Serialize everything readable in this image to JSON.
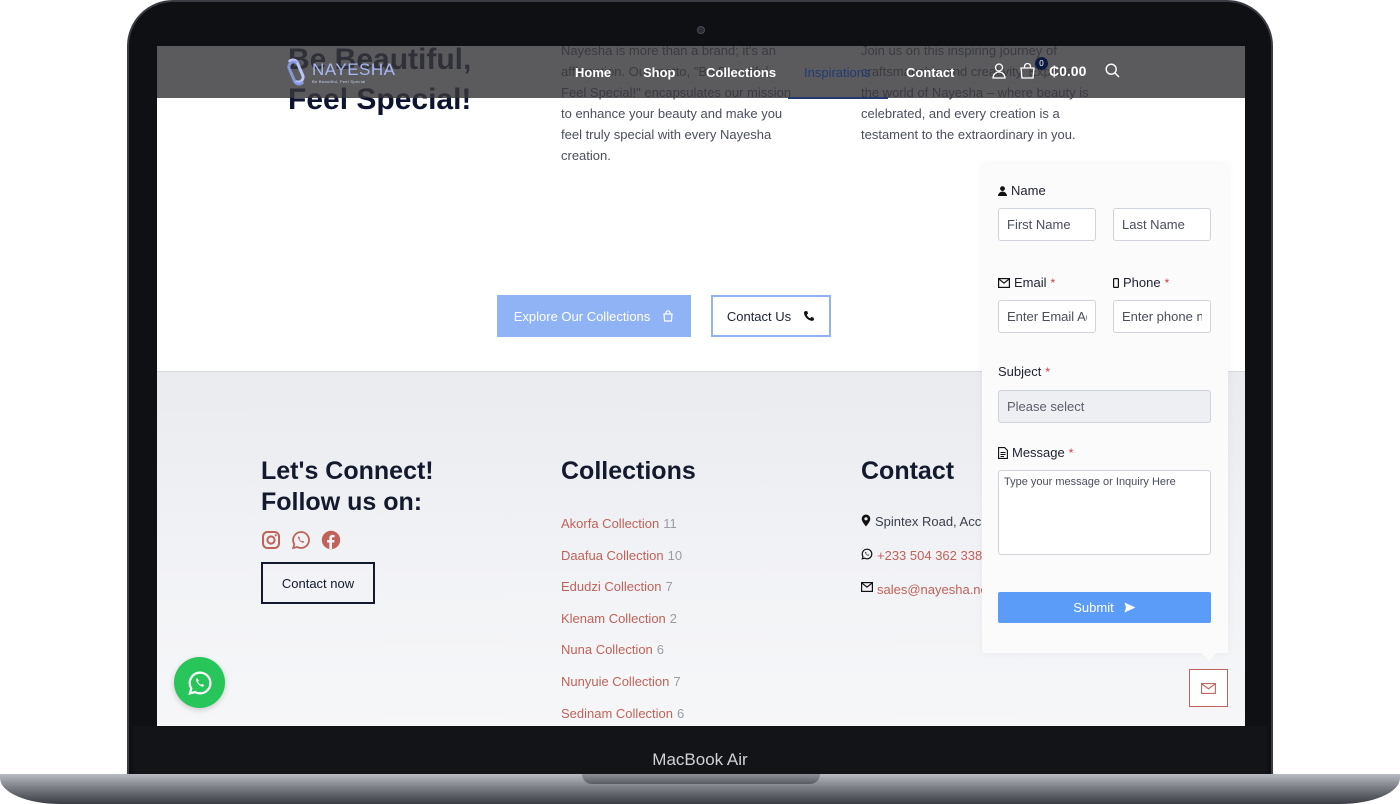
{
  "device": {
    "label": "MacBook Air"
  },
  "hero": {
    "title": "Be Beautiful, Feel Special!",
    "col1": "Nayesha is more than a brand; it's an affirmation. Our motto, \"Be Beautiful, Feel Special!\" encapsulates our mission to enhance your beauty and make you feel truly special with every Nayesha creation.",
    "col2": "Join us on this inspiring journey of craftsmanship and creativity. Explore the world of Nayesha – where beauty is celebrated, and every creation is a testament to the extraordinary in you.",
    "explore_label": "Explore Our Collections",
    "contact_label": "Contact Us"
  },
  "header": {
    "logo_name": "NAYESHA",
    "logo_tagline": "Be Beautiful, Feel Special",
    "nav": {
      "home": "Home",
      "shop": "Shop",
      "collections": "Collections",
      "inspirations": "Inspirations",
      "contact": "Contact"
    },
    "cart_count": "0",
    "cart_total": "₵0.00"
  },
  "footer": {
    "connect_heading": "Let's Connect! Follow us on:",
    "contact_now_label": "Contact now",
    "collections_heading": "Collections",
    "contact_heading": "Contact",
    "collections": [
      {
        "name": "Akorfa Collection",
        "count": "11"
      },
      {
        "name": "Daafua Collection",
        "count": "10"
      },
      {
        "name": "Edudzi Collection",
        "count": "7"
      },
      {
        "name": "Klenam Collection",
        "count": "2"
      },
      {
        "name": "Nuna Collection",
        "count": "6"
      },
      {
        "name": "Nunyuie Collection",
        "count": "7"
      },
      {
        "name": "Sedinam Collection",
        "count": "6"
      }
    ],
    "contact": {
      "address": "Spintex Road, Accr",
      "phone": "+233 504 362 338",
      "email": "sales@nayesha.ne"
    }
  },
  "form": {
    "name_label": "Name",
    "first_name_placeholder": "First Name",
    "last_name_placeholder": "Last Name",
    "email_label": "Email",
    "email_placeholder": "Enter Email Ad",
    "phone_label": "Phone",
    "phone_placeholder": "Enter phone n",
    "subject_label": "Subject",
    "subject_value": "Please select",
    "message_label": "Message",
    "message_placeholder": "Type your message or Inquiry Here",
    "required_mark": "*",
    "submit_label": "Submit"
  },
  "colors": {
    "brand_navy": "#0e1430",
    "accent_rose": "#c0625a",
    "button_blue": "#5b9cf8",
    "whatsapp_green": "#27c55a"
  }
}
